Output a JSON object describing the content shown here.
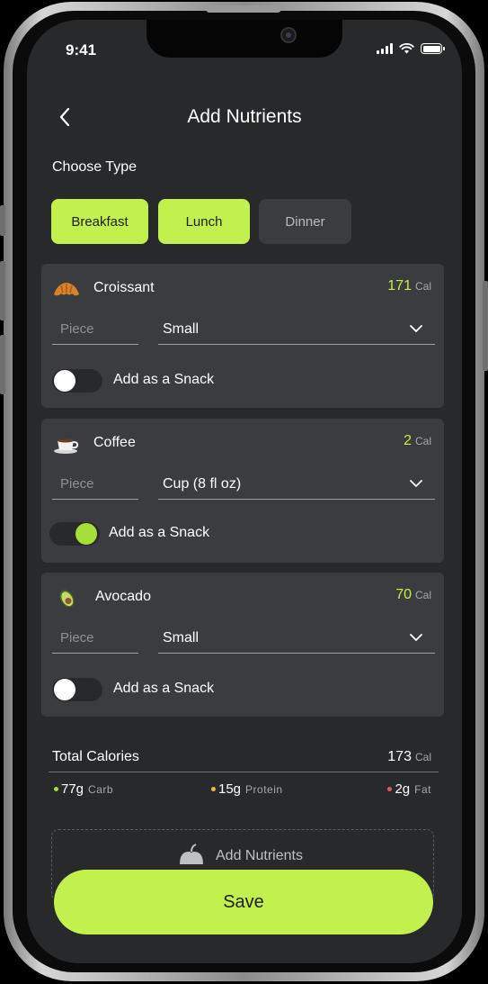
{
  "status_bar": {
    "time": "9:41"
  },
  "header": {
    "title": "Add Nutrients",
    "back_icon": "chevron-left-icon"
  },
  "choose_type": {
    "label": "Choose Type",
    "options": [
      {
        "label": "Breakfast",
        "selected": true
      },
      {
        "label": "Lunch",
        "selected": true
      },
      {
        "label": "Dinner",
        "selected": false
      }
    ]
  },
  "items": [
    {
      "icon": "croissant-icon",
      "name": "Croissant",
      "calories": "171",
      "cal_unit": "Cal",
      "piece_placeholder": "Piece",
      "size": "Small",
      "snack_label": "Add as a Snack",
      "snack_on": false
    },
    {
      "icon": "coffee-cup-icon",
      "name": "Coffee",
      "calories": "2",
      "cal_unit": "Cal",
      "piece_placeholder": "Piece",
      "size": "Cup (8 fl oz)",
      "snack_label": "Add as a Snack",
      "snack_on": true
    },
    {
      "icon": "avocado-icon",
      "name": "Avocado",
      "calories": "70",
      "cal_unit": "Cal",
      "piece_placeholder": "Piece",
      "size": "Small",
      "snack_label": "Add as a Snack",
      "snack_on": false
    }
  ],
  "totals": {
    "label": "Total Calories",
    "value": "173",
    "unit": "Cal",
    "macros": [
      {
        "value": "77g",
        "label": "Carb",
        "color": "#a6df3c"
      },
      {
        "value": "15g",
        "label": "Protein",
        "color": "#f0b93a"
      },
      {
        "value": "2g",
        "label": "Fat",
        "color": "#e05a5a"
      }
    ]
  },
  "add_nutrients": {
    "label": "Add Nutrients",
    "icon": "apple-icon"
  },
  "save": {
    "label": "Save"
  },
  "colors": {
    "accent": "#c2f04c",
    "background": "#27292b",
    "card": "#3a3c3f"
  }
}
